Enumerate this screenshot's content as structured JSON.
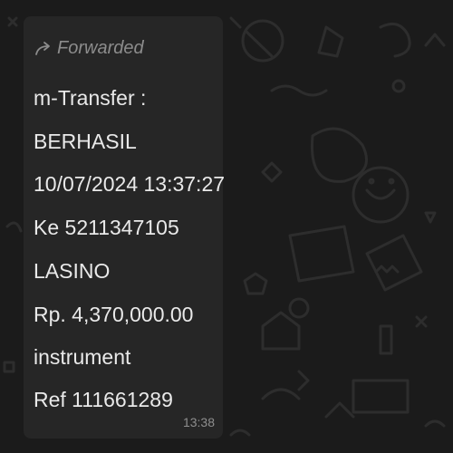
{
  "message": {
    "forwarded_label": "Forwarded",
    "lines": [
      "m-Transfer :",
      "BERHASIL",
      "10/07/2024 13:37:27",
      "Ke 5211347105",
      "LASINO",
      "Rp. 4,370,000.00",
      "instrument",
      "Ref 111661289"
    ],
    "time": "13:38"
  },
  "icons": {
    "forward": "forward-arrow-icon"
  },
  "colors": {
    "background": "#1b1b1b",
    "bubble": "#262626",
    "text": "#e9e9e9",
    "muted": "#8c8c8c"
  }
}
